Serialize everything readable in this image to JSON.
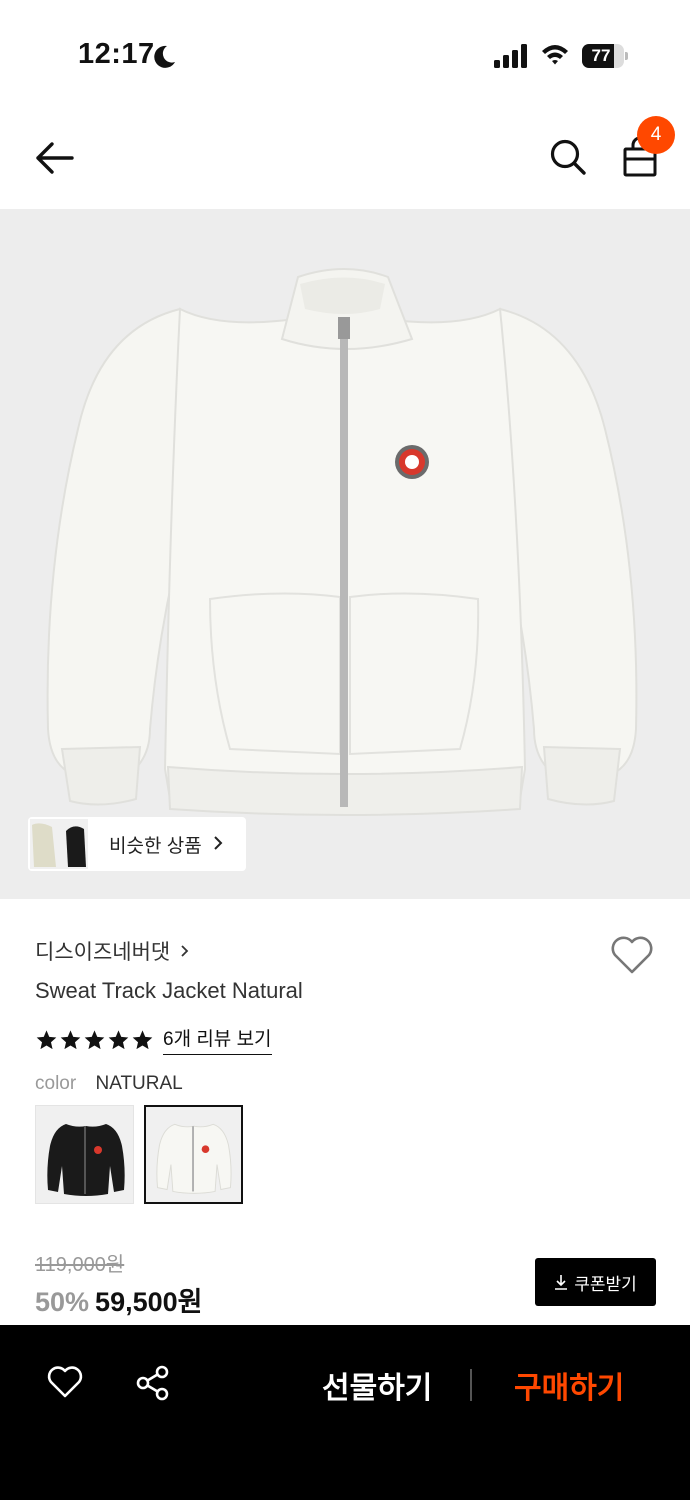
{
  "status_bar": {
    "time": "12:17",
    "battery": "77",
    "battery_level": 0.77
  },
  "header": {
    "cart_count": "4",
    "icons": [
      "back-arrow-icon",
      "search-icon",
      "shopping-bag-icon"
    ]
  },
  "image_overlay": {
    "similar_products_label": "비슷한 상품"
  },
  "product": {
    "brand": "디스이즈네버댓",
    "title": "Sweat Track Jacket Natural",
    "rating_stars": 5,
    "review_link": "6개 리뷰 보기",
    "color_label": "color",
    "color_value": "NATURAL",
    "color_options": [
      "BLACK",
      "NATURAL"
    ],
    "original_price": "119,000원",
    "discount": "50%",
    "final_price": "59,500원",
    "coupon_label": "쿠폰받기"
  },
  "bottom_bar": {
    "gift_label": "선물하기",
    "buy_label": "구매하기"
  },
  "colors": {
    "accent": "#ff4800",
    "bottom_bar_bg": "#000000",
    "image_bg": "#ededed"
  }
}
